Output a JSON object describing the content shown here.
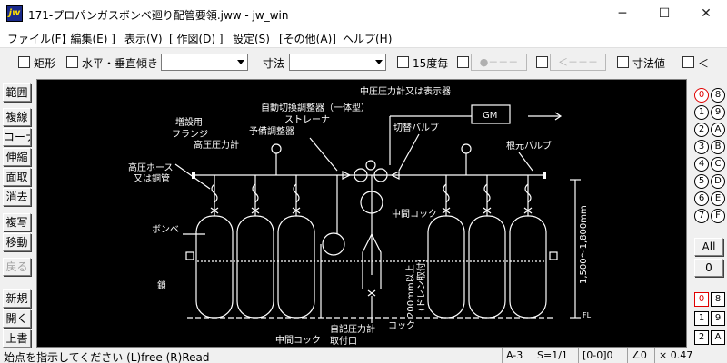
{
  "window": {
    "app_icon_text": "jw",
    "title": "171-プロパンガスボンベ廻り配管要領.jww - jw_win",
    "minimize_glyph": "─",
    "maximize_glyph": "☐",
    "close_glyph": "✕"
  },
  "menu": {
    "items": [
      "ファイル(F)",
      "[ 編集(E) ]",
      "表示(V)",
      "[ 作図(D) ]",
      "設定(S)",
      "[その他(A)]",
      "ヘルプ(H)"
    ]
  },
  "toolbar": {
    "rect_label": "矩形",
    "horiz_vert_label": "水平・垂直",
    "angle_label": "傾き",
    "angle_value": "",
    "dim_label": "寸法",
    "dim_value": "",
    "deg15_label": "15度毎",
    "circle_disabled": "●－－－",
    "arrow_disabled": "＜－－－",
    "dimval_label": "寸法値",
    "lt_label": "＜"
  },
  "left_tools": [
    "範囲",
    "複線",
    "コーナー",
    "伸縮",
    "面取",
    "消去",
    "複写",
    "移動",
    "戻る",
    "新規",
    "開く",
    "上書"
  ],
  "right_palette": {
    "layer_groups_top": [
      [
        "0",
        "8"
      ],
      [
        "1",
        "9"
      ],
      [
        "2",
        "A"
      ],
      [
        "3",
        "B"
      ],
      [
        "4",
        "C"
      ],
      [
        "5",
        "D"
      ],
      [
        "6",
        "E"
      ],
      [
        "7",
        "F"
      ]
    ],
    "all_label": "All",
    "zero_label": "0",
    "layers_bottom": [
      [
        "0",
        "8"
      ],
      [
        "1",
        "9"
      ],
      [
        "2",
        "A"
      ]
    ]
  },
  "drawing": {
    "labels": {
      "medium_pressure_gauge": "中圧圧力計又は表示器",
      "auto_regulator": "自動切換調整器（一体型）",
      "strainer": "ストレーナ",
      "spare_regulator": "予備調整器",
      "switch_valve": "切替バルブ",
      "expansion_flange_1": "増設用",
      "expansion_flange_2": "フランジ",
      "high_pressure_gauge": "高圧圧力計",
      "root_valve": "根元バルブ",
      "high_hose_1": "高圧ホース",
      "high_hose_2": "又は銅管",
      "intermediate_cock": "中間コック",
      "cylinder": "ボンベ",
      "chain": "鎖",
      "gm": "GM",
      "height": "1,500～1,800mm",
      "fl": "FL",
      "min200": "200mm以上",
      "min200_sub": "(ドレン取付)",
      "cock": "コック",
      "self_gauge": "自記圧力計",
      "mount": "取付口",
      "intermediate_cock_2": "中間コック"
    }
  },
  "status": {
    "message": "始点を指示してください (L)free (R)Read",
    "paper": "A-3",
    "scale": "S=1/1",
    "layer": "[0-0]0",
    "angle": "∠0",
    "factor": "× 0.47"
  }
}
